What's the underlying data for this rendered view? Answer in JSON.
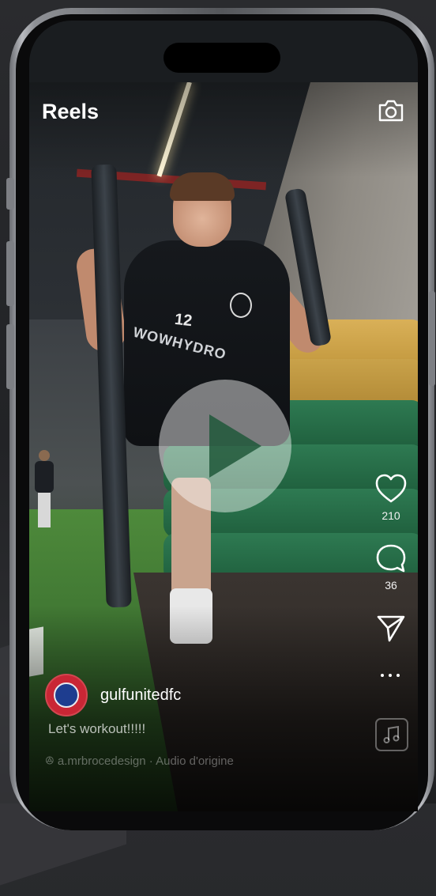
{
  "header": {
    "title": "Reels",
    "camera_icon": "camera-icon"
  },
  "post": {
    "username": "gulfunitedfc",
    "caption": "Let's workout!!!!!",
    "audio_line": "ꔮ  a.mrbrocedesign · Audio d'origine",
    "jersey_number": "12",
    "jersey_sponsor": "WOWHYDRO"
  },
  "actions": {
    "likes": "210",
    "comments": "36",
    "like_icon": "heart-icon",
    "comment_icon": "comment-icon",
    "share_icon": "send-icon",
    "more_icon": "more-icon",
    "audio_icon": "music-icon"
  },
  "colors": {
    "accent_red": "#c92635",
    "plate_green": "#2e7a52",
    "plate_yellow": "#d9b058",
    "play_overlay": "#ffffff"
  }
}
